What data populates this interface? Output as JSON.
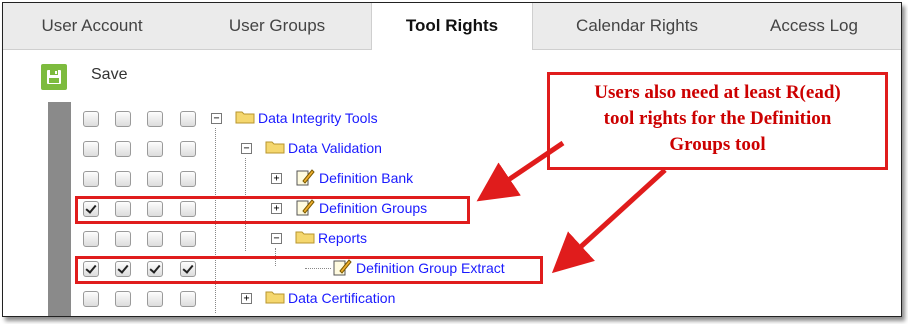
{
  "tabs": [
    {
      "label": "User Account",
      "active": false
    },
    {
      "label": "User Groups",
      "active": false
    },
    {
      "label": "Tool Rights",
      "active": true
    },
    {
      "label": "Calendar Rights",
      "active": false
    },
    {
      "label": "Access Log",
      "active": false
    }
  ],
  "toolbar": {
    "save_label": "Save",
    "save_icon": "floppy-disk-icon"
  },
  "tree": [
    {
      "label": "Data Integrity Tools",
      "type": "folder",
      "expander": "−",
      "level": 0,
      "checks": [
        false,
        false,
        false,
        false
      ]
    },
    {
      "label": "Data Validation",
      "type": "folder",
      "expander": "−",
      "level": 1,
      "checks": [
        false,
        false,
        false,
        false
      ]
    },
    {
      "label": "Definition Bank",
      "type": "tool",
      "expander": "+",
      "level": 2,
      "checks": [
        false,
        false,
        false,
        false
      ]
    },
    {
      "label": "Definition Groups",
      "type": "tool",
      "expander": "+",
      "level": 2,
      "checks": [
        true,
        false,
        false,
        false
      ]
    },
    {
      "label": "Reports",
      "type": "folder",
      "expander": "−",
      "level": 2,
      "checks": [
        false,
        false,
        false,
        false
      ]
    },
    {
      "label": "Definition Group Extract",
      "type": "tool",
      "expander": "",
      "level": 3,
      "checks": [
        true,
        true,
        true,
        true
      ]
    },
    {
      "label": "Data Certification",
      "type": "folder",
      "expander": "+",
      "level": 1,
      "checks": [
        false,
        false,
        false,
        false
      ]
    }
  ],
  "callout": {
    "lines": [
      "Users also need at least R(ead)",
      "tool rights for the Definition",
      "Groups tool"
    ]
  },
  "colors": {
    "accent_save": "#7dbb3e",
    "annotation_red": "#e01c1c",
    "link_blue": "#1a1aff"
  }
}
